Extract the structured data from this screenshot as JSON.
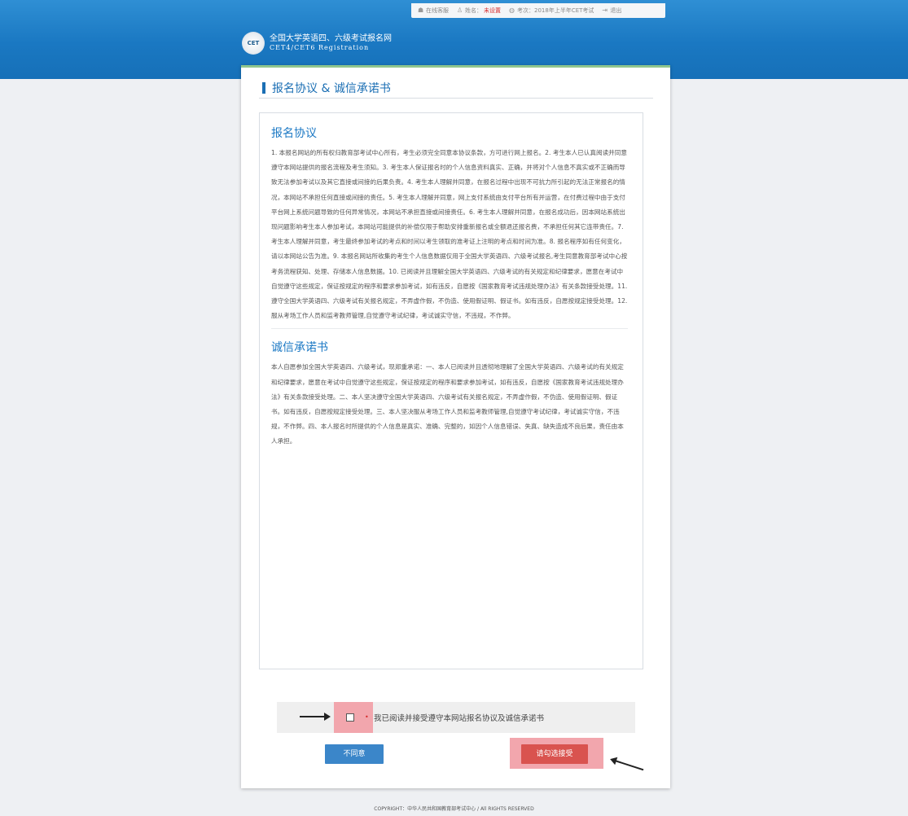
{
  "topbar": {
    "support_label": "在线客服",
    "name_prefix": "姓名：",
    "name_value": "未设置",
    "exam_label": "考次：2018年上半年CET考试",
    "logout_label": "退出"
  },
  "brand": {
    "badge_text": "CET",
    "cn_name": "全国大学英语四、六级考试报名网",
    "en_name": "CET4/CET6  Registration"
  },
  "page": {
    "title": "报名协议 & 诚信承诺书"
  },
  "agreement": {
    "heading": "报名协议",
    "text": "1. 本报名网站的所有权归教育部考试中心所有，考生必须完全同意本协议条款，方可进行网上报名。2. 考生本人已认真阅读并同意遵守本网站提供的报名流程及考生须知。3. 考生本人保证报名时的个人信息资料真实、正确，并将对个人信息不真实或不正确而导致无法参加考试以及其它直接或间接的后果负责。4. 考生本人理解并同意，在报名过程中出现不可抗力所引起的无法正常报名的情况，本网站不承担任何直接或间接的责任。5. 考生本人理解并同意，网上支付系统由支付平台所有并运营，在付费过程中由于支付平台网上系统问题导致的任何异常情况，本网站不承担直接或间接责任。6. 考生本人理解并同意，在报名成功后，因本网站系统出现问题影响考生本人参加考试，本网站可能提供的补偿仅限于帮助安排重新报名或全额退还报名费，不承担任何其它连带责任。7. 考生本人理解并同意，考生最终参加考试的考点和时间以考生领取的准考证上注明的考点和时间为准。8. 报名程序如有任何变化，请以本网站公告为准。9. 本报名网站所收集的考生个人信息数据仅用于全国大学英语四、六级考试报名,考生同意教育部考试中心按考务流程获知、处理、存储本人信息数据。10. 已阅读并且理解全国大学英语四、六级考试的有关规定和纪律要求，愿意在考试中自觉遵守这些规定，保证按规定的程序和要求参加考试，如有违反，自愿按《国家教育考试违规处理办法》有关条款接受处理。11. 遵守全国大学英语四、六级考试有关报名规定，不弄虚作假，不伪造、使用假证明、假证书。如有违反，自愿按规定接受处理。12. 服从考场工作人员和监考教师管理,自觉遵守考试纪律，考试诚实守信，不违规，不作弊。"
  },
  "pledge": {
    "heading": "诚信承诺书",
    "text": "本人自愿参加全国大学英语四、六级考试，现郑重承诺：一、本人已阅读并且透彻地理解了全国大学英语四、六级考试的有关规定和纪律要求，愿意在考试中自觉遵守这些规定，保证按规定的程序和要求参加考试，如有违反，自愿按《国家教育考试违规处理办法》有关条款接受处理。二、本人坚决遵守全国大学英语四、六级考试有关报名规定，不弄虚作假，不伪造、使用假证明、假证书。如有违反，自愿按规定接受处理。三、本人坚决服从考场工作人员和监考教师管理,自觉遵守考试纪律，考试诚实守信，不违规，不作弊。四、本人报名时所提供的个人信息是真实、准确、完整的，如因个人信息错误、失真、缺失造成不良后果，责任由本人承担。"
  },
  "consent": {
    "required_mark": "•",
    "label": "我已阅读并接受遵守本网站报名协议及诚信承诺书"
  },
  "buttons": {
    "disagree": "不同意",
    "accept": "请勾选接受"
  },
  "footer": {
    "copyright": "COPYRIGHT：中华人民共和国教育部考试中心 / All RIGHTS RESERVED"
  },
  "colors": {
    "header_blue": "#1a78c2",
    "accent_blue": "#1b6fb4",
    "accept_red": "#d9534f",
    "highlight_pink": "#f2a6ad",
    "warn_red": "#d62b2b"
  }
}
